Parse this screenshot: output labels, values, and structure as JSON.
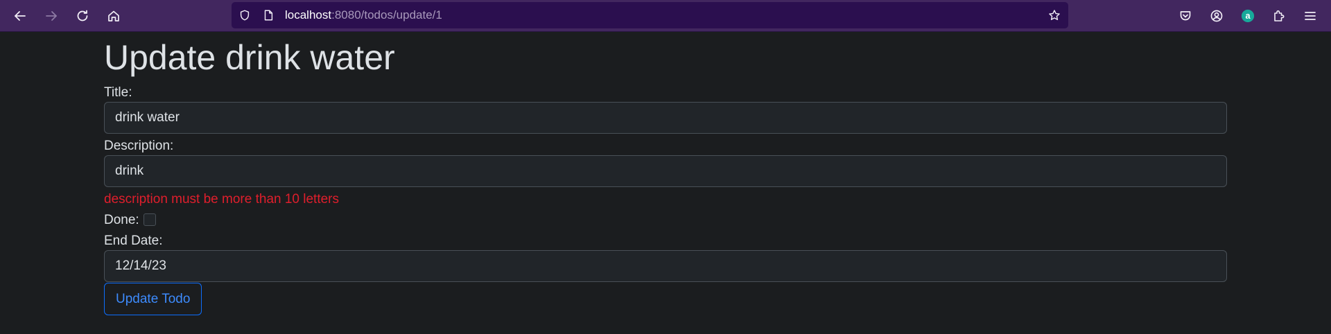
{
  "browser": {
    "url_host": "localhost",
    "url_path": ":8080/todos/update/1",
    "icons": {
      "back": "arrow-left-icon",
      "forward": "arrow-right-icon",
      "reload": "reload-icon",
      "home": "home-icon",
      "shield": "shield-icon",
      "page": "page-icon",
      "bookmark": "star-icon",
      "pocket": "pocket-icon",
      "account": "account-icon",
      "extension_avatar": "extension-avatar-icon",
      "extensions": "puzzle-icon",
      "menu": "hamburger-menu-icon"
    },
    "extension_avatar_letter": "a",
    "colors": {
      "toolbar": "#42275f",
      "urlbar": "#2b0f4f",
      "extension_avatar": "#17a99a"
    }
  },
  "page": {
    "title": "Update drink water",
    "background": "#1b1d1f"
  },
  "form": {
    "title_label": "Title:",
    "title_value": "drink water",
    "description_label": "Description:",
    "description_value": "drink",
    "description_error": "description must be more than 10 letters",
    "done_label": "Done:",
    "done_checked": false,
    "end_date_label": "End Date:",
    "end_date_value": "12/14/23",
    "submit_label": "Update Todo",
    "colors": {
      "error": "#e01e2c",
      "button_outline": "#0d6efd"
    }
  }
}
